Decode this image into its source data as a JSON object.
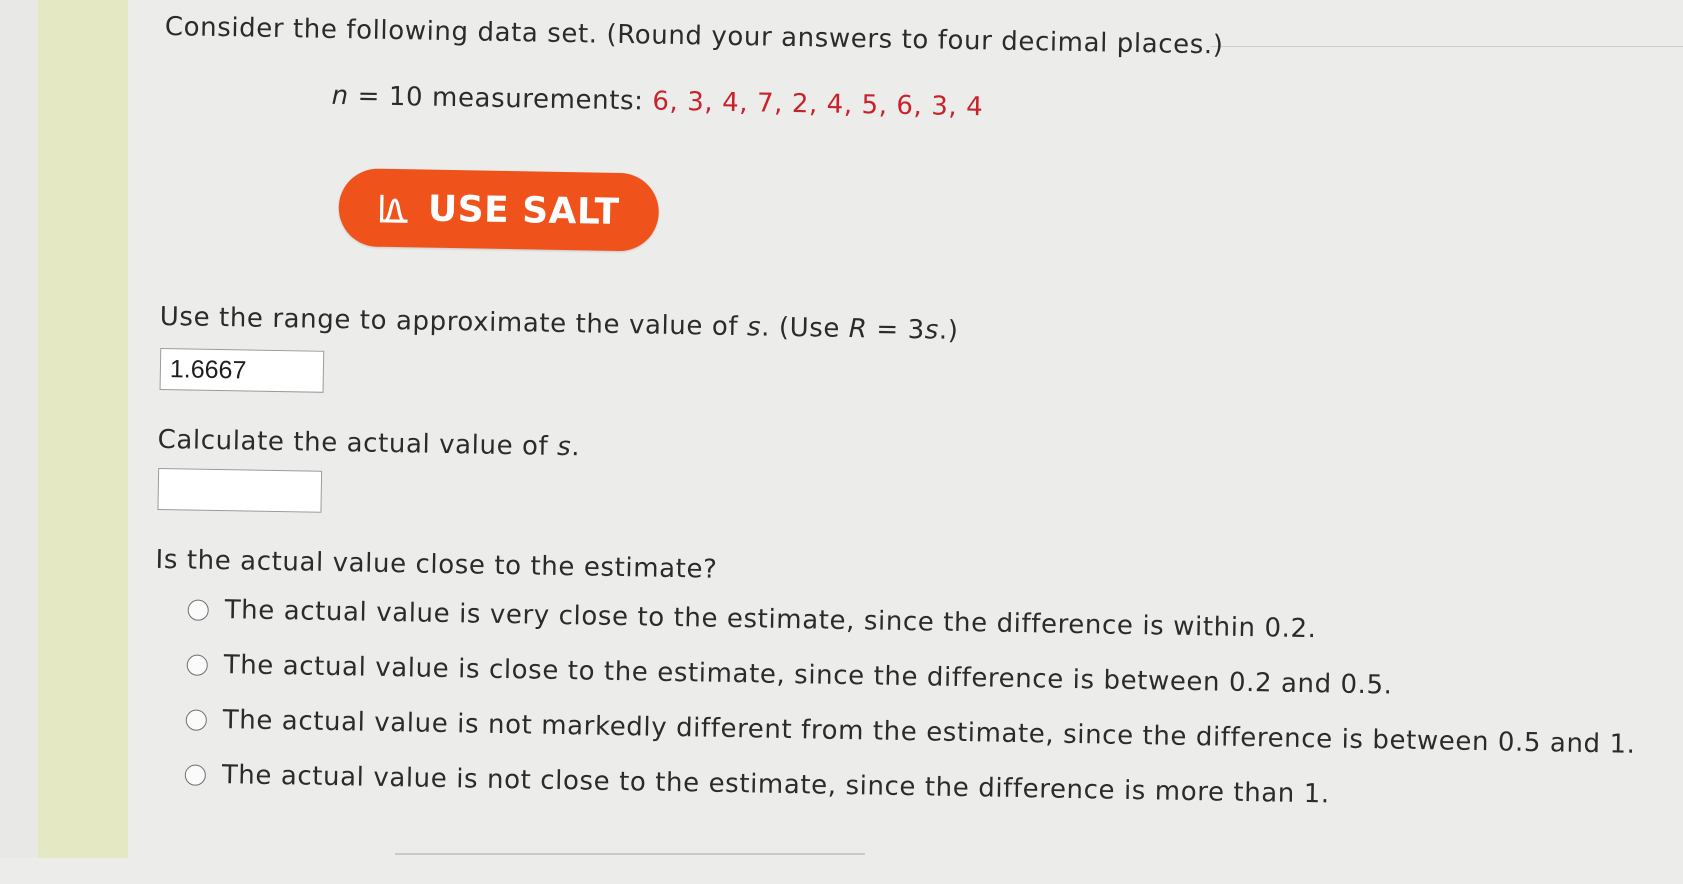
{
  "question": {
    "intro": "Consider the following data set. (Round your answers to four decimal places.)",
    "n_var": "n",
    "n_eq": " = 10 measurements: ",
    "values": "6, 3, 4, 7, 2, 4, 5, 6, 3, 4"
  },
  "salt_button": {
    "label": "USE SALT",
    "color": "#f0521b",
    "icon": "bell-curve-icon"
  },
  "range_question": {
    "text_before": "Use the range to approximate the value of ",
    "s": "s",
    "text_mid": ". (Use ",
    "R": "R",
    "eq": " = 3",
    "s2": "s",
    "text_end": ".)",
    "answer_value": "1.6667"
  },
  "actual_question": {
    "text_before": "Calculate the actual value of ",
    "s": "s",
    "text_end": ".",
    "answer_value": ""
  },
  "close_question": {
    "text": "Is the actual value close to the estimate?",
    "options": [
      "The actual value is very close to the estimate, since the difference is within 0.2.",
      "The actual value is close to the estimate, since the difference is between 0.2 and 0.5.",
      "The actual value is not markedly different from the estimate, since the difference is between 0.5 and 1.",
      "The actual value is not close to the estimate, since the difference is more than 1."
    ]
  },
  "colors": {
    "data_red": "#c8232b",
    "sidebar": "#e4e9c3"
  }
}
